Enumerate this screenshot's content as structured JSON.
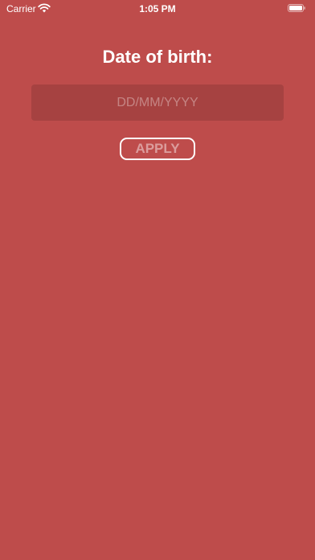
{
  "status_bar": {
    "carrier": "Carrier",
    "time": "1:05 PM",
    "icons": [
      "wifi-icon",
      "battery-icon"
    ]
  },
  "form": {
    "title": "Date of birth:",
    "dob_placeholder": "DD/MM/YYYY",
    "dob_value": "",
    "apply_label": "APPLY"
  },
  "colors": {
    "background": "#be4c4b",
    "text": "#ffffff"
  }
}
